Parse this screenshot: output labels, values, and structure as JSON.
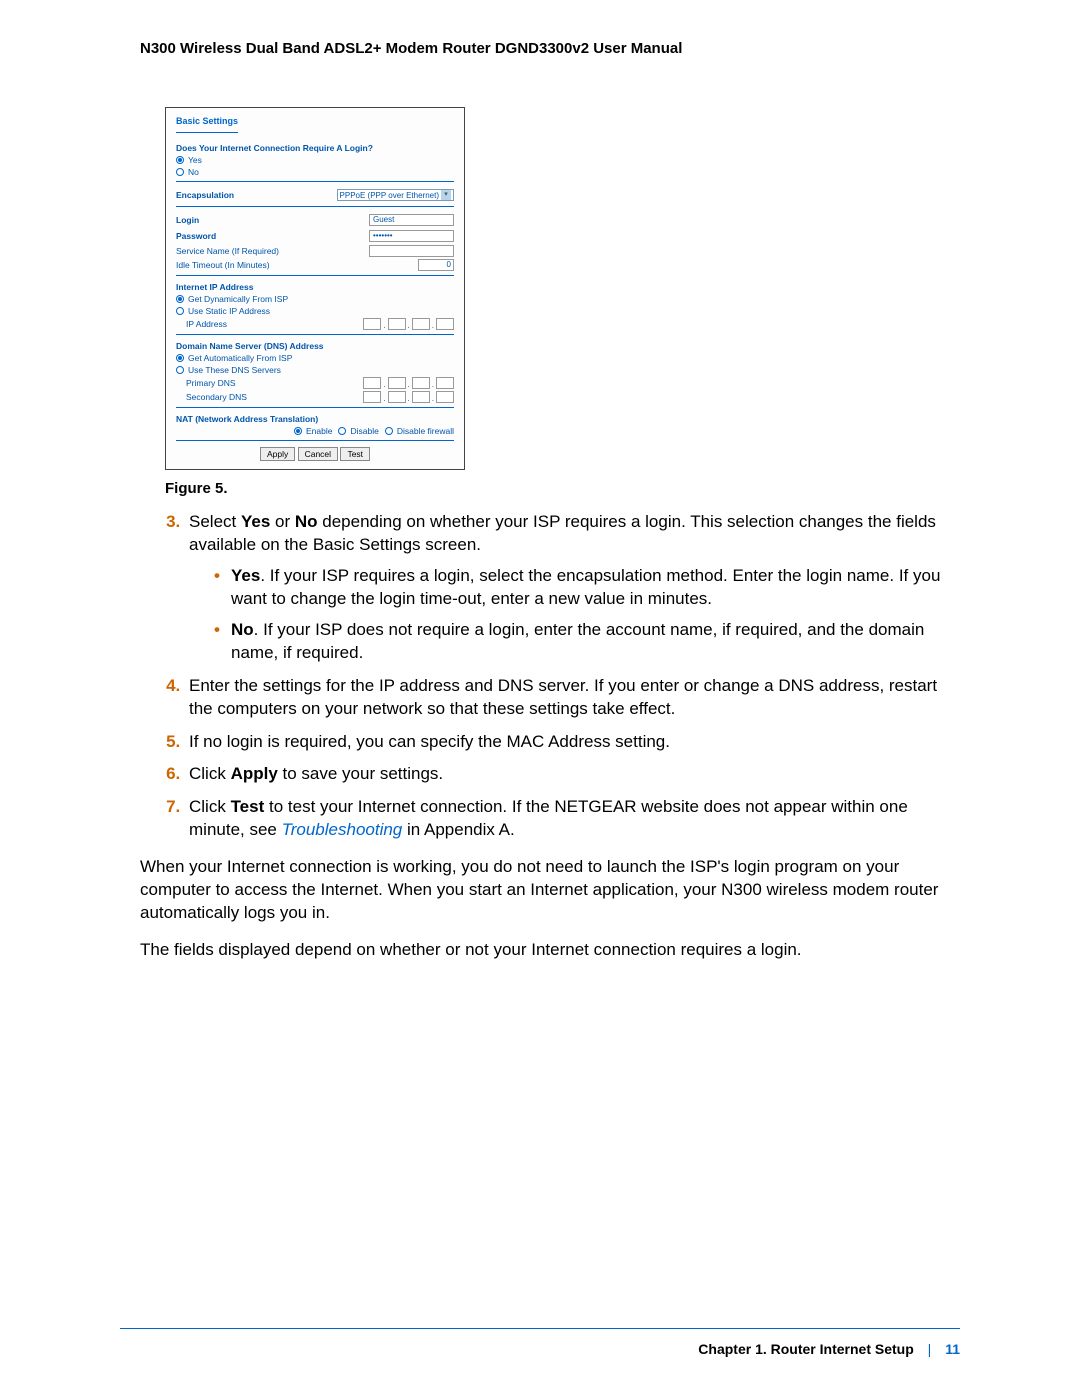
{
  "header": {
    "title": "N300 Wireless Dual Band ADSL2+ Modem Router DGND3300v2 User Manual"
  },
  "figure": {
    "caption": "Figure 5.",
    "panel_title": "Basic Settings",
    "q_login": "Does Your Internet Connection Require A Login?",
    "yes": "Yes",
    "no": "No",
    "encapsulation": "Encapsulation",
    "encap_value": "PPPoE (PPP over Ethernet)",
    "login": "Login",
    "login_value": "Guest",
    "password": "Password",
    "password_value": "•••••••",
    "service_name": "Service Name (If Required)",
    "idle_timeout": "Idle Timeout (In Minutes)",
    "idle_timeout_value": "0",
    "ip_section": "Internet IP Address",
    "get_dynamic": "Get Dynamically From ISP",
    "use_static": "Use Static IP Address",
    "ip_address": "IP Address",
    "dns_section": "Domain Name Server (DNS) Address",
    "get_auto": "Get Automatically From ISP",
    "use_these": "Use These DNS Servers",
    "primary_dns": "Primary DNS",
    "secondary_dns": "Secondary DNS",
    "nat_section": "NAT (Network Address Translation)",
    "enable": "Enable",
    "disable": "Disable",
    "disable_fw": "Disable firewall",
    "apply": "Apply",
    "cancel": "Cancel",
    "test": "Test"
  },
  "steps": {
    "s3_a": "Select ",
    "s3_yes": "Yes",
    "s3_b": " or ",
    "s3_no": "No",
    "s3_c": " depending on whether your ISP requires a login. This selection changes the fields available on the Basic Settings screen.",
    "s3_yes_label": "Yes",
    "s3_yes_text": ". If your ISP requires a login, select the encapsulation method. Enter the login name. If you want to change the login time-out, enter a new value in minutes.",
    "s3_no_label": "No",
    "s3_no_text": ". If your ISP does not require a login, enter the account name, if required, and the domain name, if required.",
    "s4": "Enter the settings for the IP address and DNS server. If you enter or change a DNS address, restart the computers on your network so that these settings take effect.",
    "s5": "If no login is required, you can specify the MAC Address setting.",
    "s6_a": "Click ",
    "s6_apply": "Apply",
    "s6_b": " to save your settings.",
    "s7_a": "Click ",
    "s7_test": "Test",
    "s7_b": " to test your Internet connection. If the NETGEAR website does not appear within one minute, see ",
    "s7_link": "Troubleshooting",
    "s7_c": " in Appendix A."
  },
  "paragraphs": {
    "p1": "When your Internet connection is working, you do not need to launch the ISP's login program on your computer to access the Internet. When you start an Internet application, your N300 wireless modem router automatically logs you in.",
    "p2": "The fields displayed depend on whether or not your Internet connection requires a login."
  },
  "footer": {
    "chapter": "Chapter 1.  Router Internet Setup",
    "page": "11"
  }
}
